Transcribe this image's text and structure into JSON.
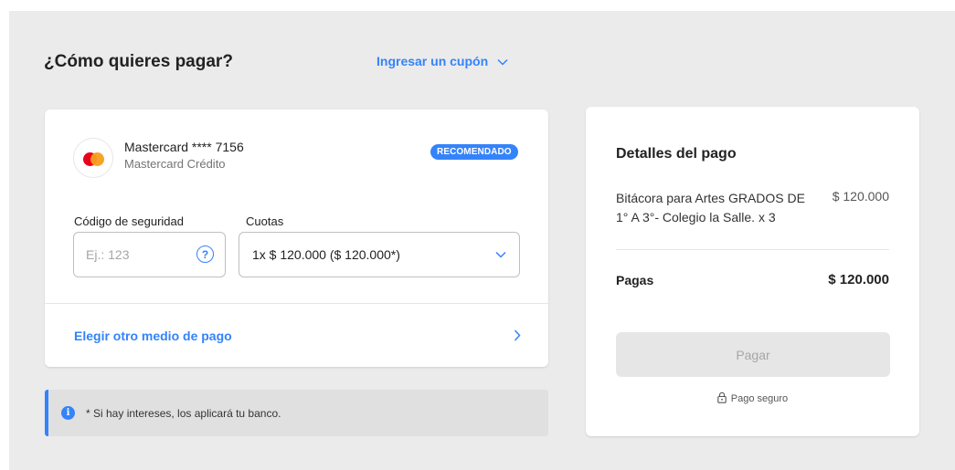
{
  "header": {
    "title": "¿Cómo quieres pagar?",
    "coupon_label": "Ingresar un cupón"
  },
  "payment_card": {
    "brand": "Mastercard **** 7156",
    "type": "Mastercard Crédito",
    "badge": "RECOMENDADO",
    "security_code": {
      "label": "Código de seguridad",
      "placeholder": "Ej.: 123",
      "help_symbol": "?"
    },
    "installments": {
      "label": "Cuotas",
      "selected": "1x $ 120.000 ($ 120.000*)"
    },
    "other_method_label": "Elegir otro medio de pago"
  },
  "notice": {
    "info_symbol": "i",
    "text": "* Si hay intereses, los aplicará tu banco."
  },
  "summary": {
    "title": "Detalles del pago",
    "item_name": "Bitácora para Artes GRADOS DE 1° A 3°- Colegio la Salle. x 3",
    "item_price": "$ 120.000",
    "total_label": "Pagas",
    "total_value": "$ 120.000",
    "pay_button": "Pagar",
    "secure_label": "Pago seguro"
  },
  "colors": {
    "accent": "#3483fa",
    "background": "#ebebeb",
    "card": "#ffffff",
    "mastercard_red": "#eb001b",
    "mastercard_yellow": "#f79e1b",
    "disabled_button": "#e6e6e6"
  },
  "icons": {
    "coupon": "chevron-down-icon",
    "help": "question-circle-icon",
    "select": "chevron-down-icon",
    "other_method": "chevron-right-icon",
    "notice": "info-icon",
    "secure": "lock-icon",
    "card_brand": "mastercard-logo-icon"
  }
}
